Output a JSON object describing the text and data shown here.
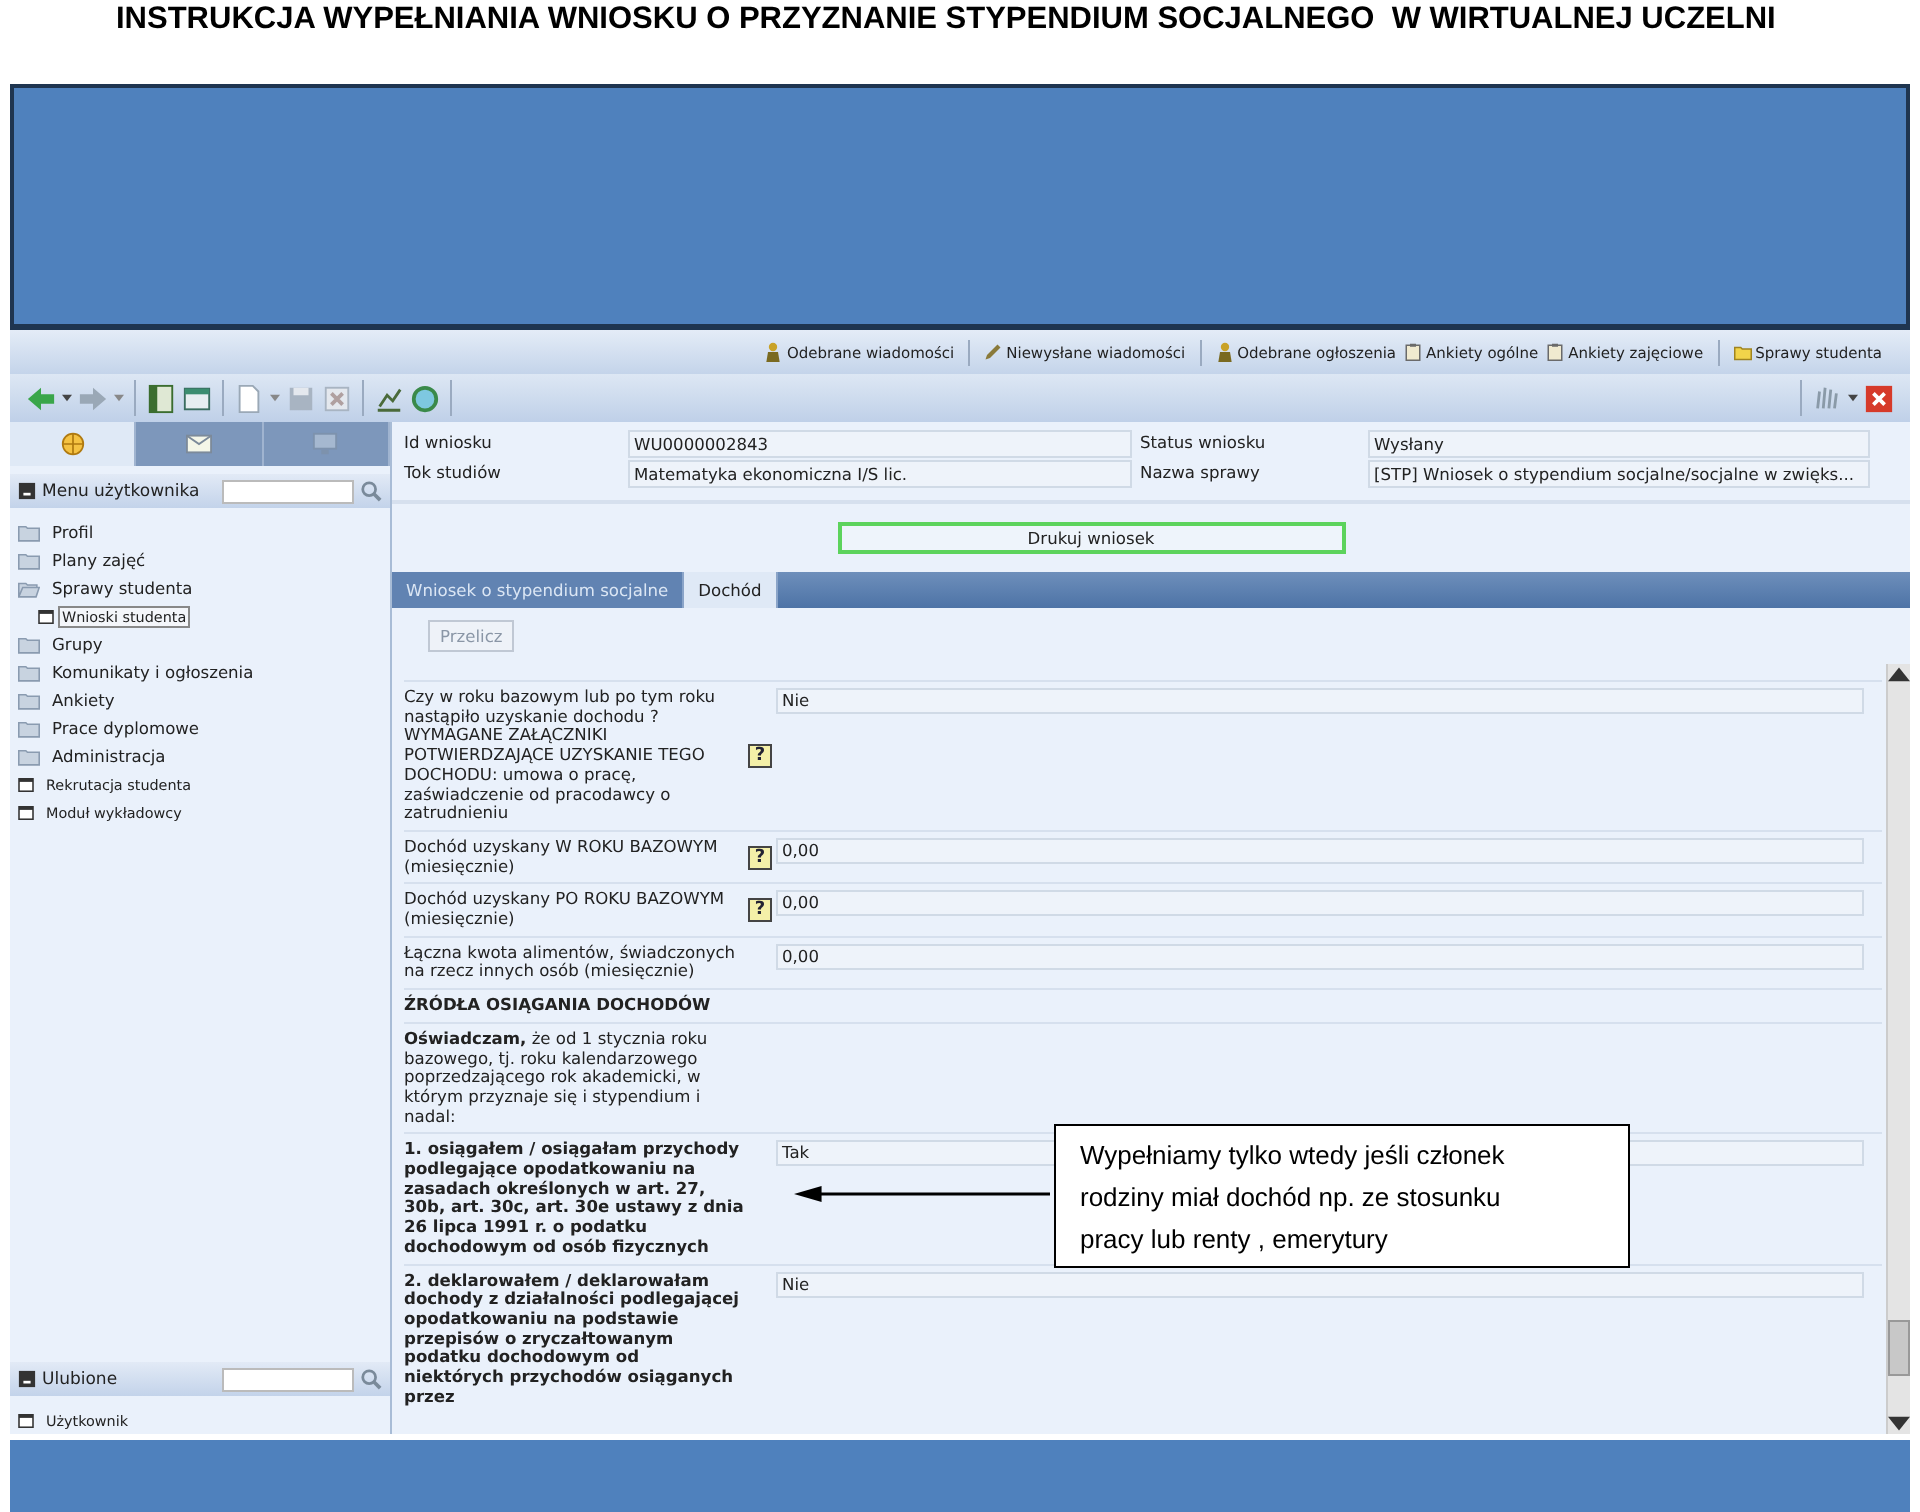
{
  "title": "INSTRUKCJA WYPEŁNIANIA WNIOSKU O PRZYZNANIE STYPENDIUM SOCJALNEGO  W WIRTUALNEJ UCZELNI",
  "top_links": [
    {
      "label": "Odebrane wiadomości",
      "kind": "person"
    },
    {
      "label": "Niewysłane wiadomości",
      "kind": "pencil"
    },
    {
      "label": "Odebrane ogłoszenia",
      "kind": "person"
    },
    {
      "label": "Ankiety ogólne",
      "kind": "clipboard"
    },
    {
      "label": "Ankiety zajęciowe",
      "kind": "clipboard"
    },
    {
      "label": "Sprawy studenta",
      "kind": "folder"
    }
  ],
  "sidebar_tabs": [
    {
      "kind": "compass",
      "selected": true
    },
    {
      "kind": "mail",
      "selected": false
    },
    {
      "kind": "desk",
      "selected": false
    }
  ],
  "menu": {
    "title": "Menu użytkownika",
    "items": [
      {
        "label": "Profil",
        "kind": "folder",
        "expanded": false,
        "selected": false
      },
      {
        "label": "Plany zajęć",
        "kind": "folder",
        "expanded": false,
        "selected": false
      },
      {
        "label": "Sprawy studenta",
        "kind": "folder",
        "expanded": true,
        "selected": false,
        "children": [
          {
            "label": "Wnioski studenta",
            "kind": "page",
            "selected": true
          }
        ]
      },
      {
        "label": "Grupy",
        "kind": "folder",
        "expanded": false,
        "selected": false
      },
      {
        "label": "Komunikaty i ogłoszenia",
        "kind": "folder",
        "expanded": false,
        "selected": false
      },
      {
        "label": "Ankiety",
        "kind": "folder",
        "expanded": false,
        "selected": false
      },
      {
        "label": "Prace dyplomowe",
        "kind": "folder",
        "expanded": false,
        "selected": false
      },
      {
        "label": "Administracja",
        "kind": "folder",
        "expanded": false,
        "selected": false
      },
      {
        "label": "Rekrutacja studenta",
        "kind": "page",
        "selected": false
      },
      {
        "label": "Moduł wykładowcy",
        "kind": "page",
        "selected": false
      }
    ]
  },
  "favorites": {
    "title": "Ulubione",
    "items": [
      {
        "label": "Użytkownik"
      }
    ]
  },
  "info_fields": [
    {
      "label": "Id wniosku",
      "value": "WU0000002843"
    },
    {
      "label": "Status wniosku",
      "value": "Wysłany"
    },
    {
      "label": "Tok studiów",
      "value": "Matematyka ekonomiczna I/S lic."
    },
    {
      "label": "Nazwa sprawy",
      "value": "[STP] Wniosek o stypendium socjalne/socjalne w zwięks..."
    }
  ],
  "print_button": "Drukuj wniosek",
  "tabs": [
    {
      "label": "Wniosek o stypendium socjalne",
      "selected": false
    },
    {
      "label": "Dochód",
      "selected": true
    }
  ],
  "recalc_button": "Przelicz",
  "form_rows": [
    {
      "kind": "field",
      "label": "Czy w roku bazowym lub po tym roku nastąpiło uzyskanie dochodu ? WYMAGANE ZAŁĄCZNIKI POTWIERDZAJĄCE UZYSKANIE TEGO DOCHODU: umowa o pracę, zaświadczenie od pracodawcy o zatrudnieniu",
      "help": "?",
      "bold": false,
      "value": "Nie"
    },
    {
      "kind": "field",
      "label": "Dochód uzyskany W ROKU BAZOWYM (miesięcznie)",
      "help": "?",
      "bold": false,
      "value": "0,00"
    },
    {
      "kind": "field",
      "label": "Dochód uzyskany PO ROKU BAZOWYM (miesięcznie)",
      "help": "?",
      "bold": false,
      "value": "0,00"
    },
    {
      "kind": "field",
      "label": "Łączna kwota alimentów, świadczonych na rzecz innych osób (miesięcznie)",
      "bold": false,
      "value": "0,00"
    },
    {
      "kind": "heading",
      "label": "ŹRÓDŁA OSIĄGANIA DOCHODÓW"
    },
    {
      "kind": "text",
      "label": "**Oświadczam,** że od 1 stycznia roku bazowego, tj. roku kalendarzowego poprzedzającego rok akademicki, w którym przyznaje się i stypendium i nadal:"
    },
    {
      "kind": "field",
      "label": "1. osiągałem / osiągałam przychody podlegające opodatkowaniu na zasadach określonych w art. 27, 30b, art. 30c, art. 30e ustawy z dnia 26 lipca 1991 r. o podatku dochodowym od osób fizycznych",
      "bold": true,
      "value": "Tak"
    },
    {
      "kind": "field",
      "label": "2. deklarowałem / deklarowałam dochody z działalności podlegającej opodatkowaniu na podstawie przepisów o zryczałtowanym podatku dochodowym od niektórych przychodów osiąganych przez",
      "bold": true,
      "value": "Nie"
    }
  ],
  "callout": {
    "lines": [
      "Wypełniamy tylko wtedy jeśli członek",
      "rodziny miał dochód np.  ze stosunku",
      "pracy lub renty , emerytury"
    ]
  }
}
